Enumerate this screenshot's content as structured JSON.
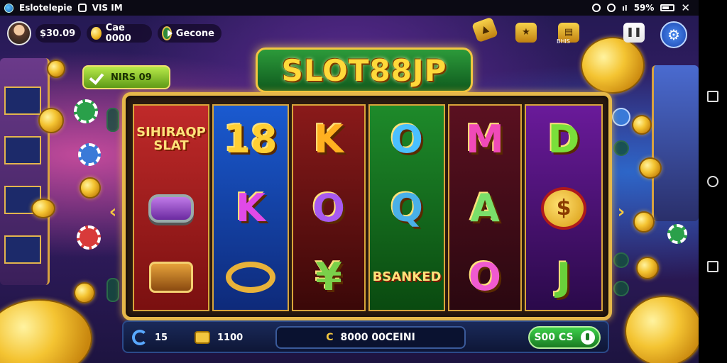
{
  "status_bar": {
    "app_label": "Eslotelepie",
    "left_extra": "VIS IM",
    "battery": "59%"
  },
  "header": {
    "balance": "$30.09",
    "coins": "Cae 0000",
    "mode": "Gecone",
    "top_icon_label": "BHIS"
  },
  "logo": {
    "text": "SLOT88JP"
  },
  "win_badge": {
    "text": "NIRS 09"
  },
  "reels": [
    {
      "id": "reel-1",
      "symbols": [
        {
          "kind": "text",
          "text": "SIHIRAQP\nSLAT"
        },
        {
          "kind": "gem"
        },
        {
          "kind": "barrel"
        }
      ]
    },
    {
      "id": "reel-2",
      "symbols": [
        {
          "kind": "letter",
          "text": "18",
          "color": "#ffcf33"
        },
        {
          "kind": "letter",
          "text": "K",
          "color": "#e04ae8"
        },
        {
          "kind": "ring"
        }
      ]
    },
    {
      "id": "reel-3",
      "symbols": [
        {
          "kind": "letter",
          "text": "K",
          "color": "#ffb020"
        },
        {
          "kind": "letter",
          "text": "O",
          "color": "#a85af0"
        },
        {
          "kind": "letter",
          "text": "¥",
          "color": "#7ad04a"
        }
      ]
    },
    {
      "id": "reel-4",
      "symbols": [
        {
          "kind": "letter",
          "text": "O",
          "color": "#4ac0ff"
        },
        {
          "kind": "letter",
          "text": "Q",
          "color": "#4ab0e8"
        },
        {
          "kind": "text",
          "text": "BSANKED"
        }
      ]
    },
    {
      "id": "reel-5",
      "symbols": [
        {
          "kind": "letter",
          "text": "M",
          "color": "#f04ab8"
        },
        {
          "kind": "letter",
          "text": "A",
          "color": "#7adf6a"
        },
        {
          "kind": "letter",
          "text": "O",
          "color": "#f05ad0"
        }
      ]
    },
    {
      "id": "reel-6",
      "symbols": [
        {
          "kind": "letter",
          "text": "D",
          "color": "#7adf3a"
        },
        {
          "kind": "bag",
          "text": "$"
        },
        {
          "kind": "letter",
          "text": "J",
          "color": "#6ad03a"
        }
      ]
    }
  ],
  "bottom_bar": {
    "lines": "15",
    "bet": "1100",
    "balance_label": "8000 00CEINI",
    "balance_currency": "C",
    "spin_label": "S00 CS"
  },
  "icons": {
    "settings": "gear-icon",
    "refresh": "refresh-icon",
    "bet": "bet-icon",
    "spin": "spin-icon"
  }
}
